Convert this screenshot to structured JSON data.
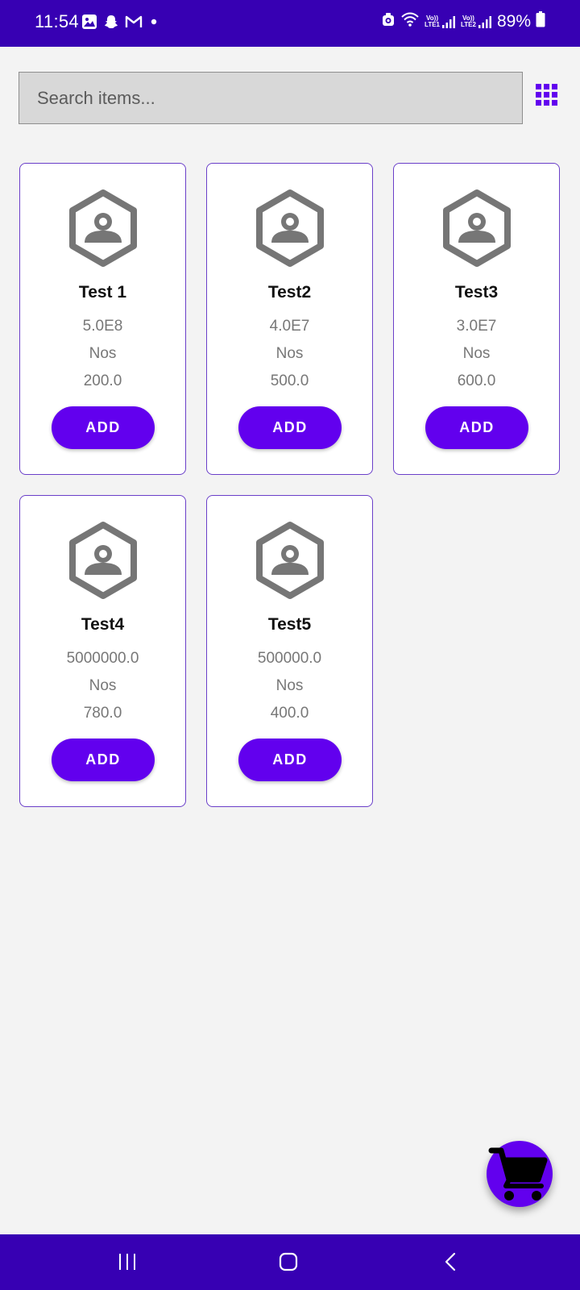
{
  "status_bar": {
    "time": "11:54",
    "left_icons": [
      "gallery-icon",
      "snapchat-icon",
      "gmail-icon",
      "dot-icon"
    ],
    "right_icons": [
      "alarm-icon",
      "wifi-icon",
      "signal-lte1-icon",
      "signal-lte2-icon",
      "battery-icon"
    ],
    "sim1_label_top": "Vo))",
    "sim1_label_bottom": "LTE1",
    "sim2_label_top": "Vo))",
    "sim2_label_bottom": "LTE2",
    "battery": "89%"
  },
  "search": {
    "placeholder": "Search items..."
  },
  "toolbar": {
    "grid_icon": "grid-view-icon"
  },
  "items": [
    {
      "name": "Test 1",
      "value": "5.0E8",
      "unit": "Nos",
      "price": "200.0",
      "button": "ADD"
    },
    {
      "name": "Test2",
      "value": "4.0E7",
      "unit": "Nos",
      "price": "500.0",
      "button": "ADD"
    },
    {
      "name": "Test3",
      "value": "3.0E7",
      "unit": "Nos",
      "price": "600.0",
      "button": "ADD"
    },
    {
      "name": "Test4",
      "value": "5000000.0",
      "unit": "Nos",
      "price": "780.0",
      "button": "ADD"
    },
    {
      "name": "Test5",
      "value": "500000.0",
      "unit": "Nos",
      "price": "400.0",
      "button": "ADD"
    }
  ],
  "fab": {
    "icon": "cart-icon"
  },
  "nav": {
    "icons": [
      "recents-icon",
      "home-icon",
      "back-icon"
    ]
  },
  "colors": {
    "status_bar": "#3700b3",
    "accent": "#6200ee",
    "card_border": "#6a3fc9",
    "background": "#f3f3f3"
  }
}
